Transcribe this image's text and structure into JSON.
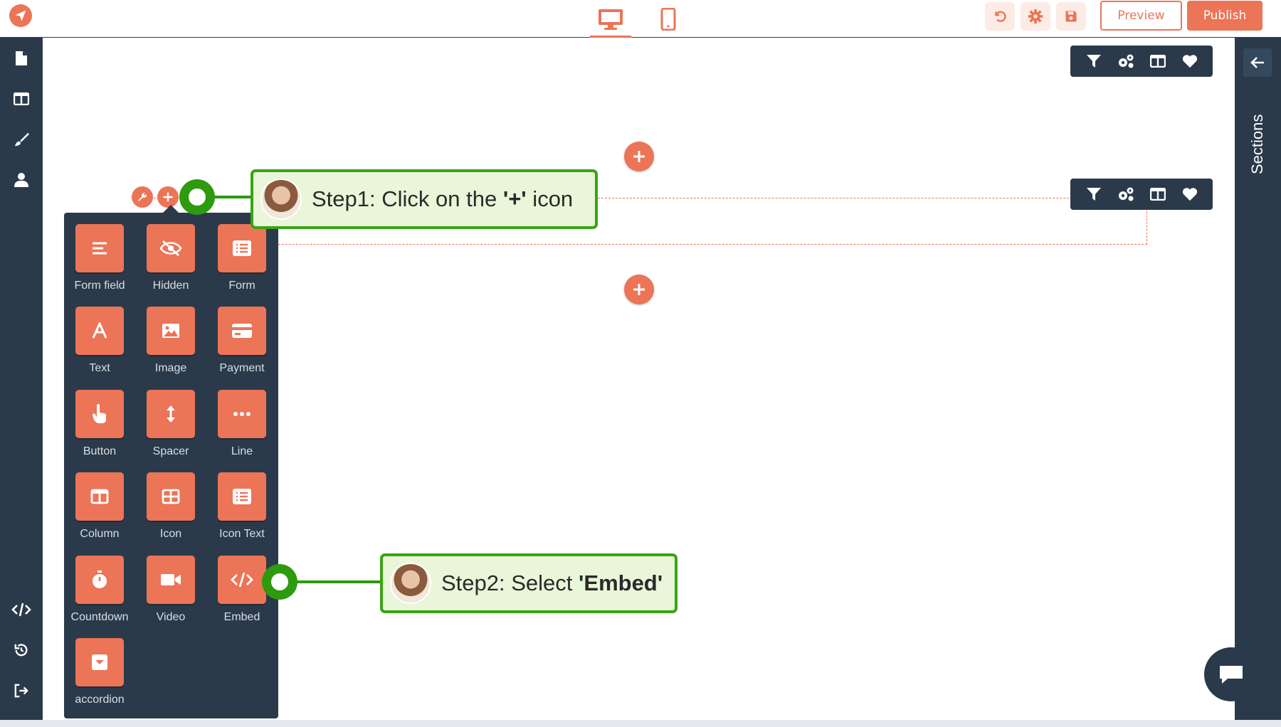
{
  "topbar": {
    "preview_label": "Preview",
    "publish_label": "Publish",
    "devices": [
      "desktop-icon",
      "mobile-icon"
    ],
    "tools": [
      "undo-icon",
      "gear-icon",
      "save-icon"
    ]
  },
  "right_panel": {
    "label": "Sections"
  },
  "elements": [
    {
      "label": "Form field",
      "icon": "form-field-icon"
    },
    {
      "label": "Hidden",
      "icon": "eye-slash-icon"
    },
    {
      "label": "Form",
      "icon": "form-icon"
    },
    {
      "label": "Text",
      "icon": "text-icon"
    },
    {
      "label": "Image",
      "icon": "image-icon"
    },
    {
      "label": "Payment",
      "icon": "credit-card-icon"
    },
    {
      "label": "Button",
      "icon": "pointer-hand-icon"
    },
    {
      "label": "Spacer",
      "icon": "arrows-vertical-icon"
    },
    {
      "label": "Line",
      "icon": "ellipsis-icon"
    },
    {
      "label": "Column",
      "icon": "columns-icon"
    },
    {
      "label": "Icon",
      "icon": "grid-icon"
    },
    {
      "label": "Icon Text",
      "icon": "list-icon"
    },
    {
      "label": "Countdown",
      "icon": "stopwatch-icon"
    },
    {
      "label": "Video",
      "icon": "video-camera-icon"
    },
    {
      "label": "Embed",
      "icon": "code-icon"
    },
    {
      "label": "accordion",
      "icon": "caret-square-icon"
    }
  ],
  "callouts": {
    "step1_prefix": "Step1: Click on the ",
    "step1_bold": "'+'",
    "step1_suffix": " icon",
    "step2_prefix": "Step2: Select ",
    "step2_bold": "'Embed'"
  },
  "colors": {
    "accent": "#ec7457",
    "dark": "#2b3a4a",
    "callout_green": "#3aa314",
    "callout_bg": "#e9f6d9"
  }
}
